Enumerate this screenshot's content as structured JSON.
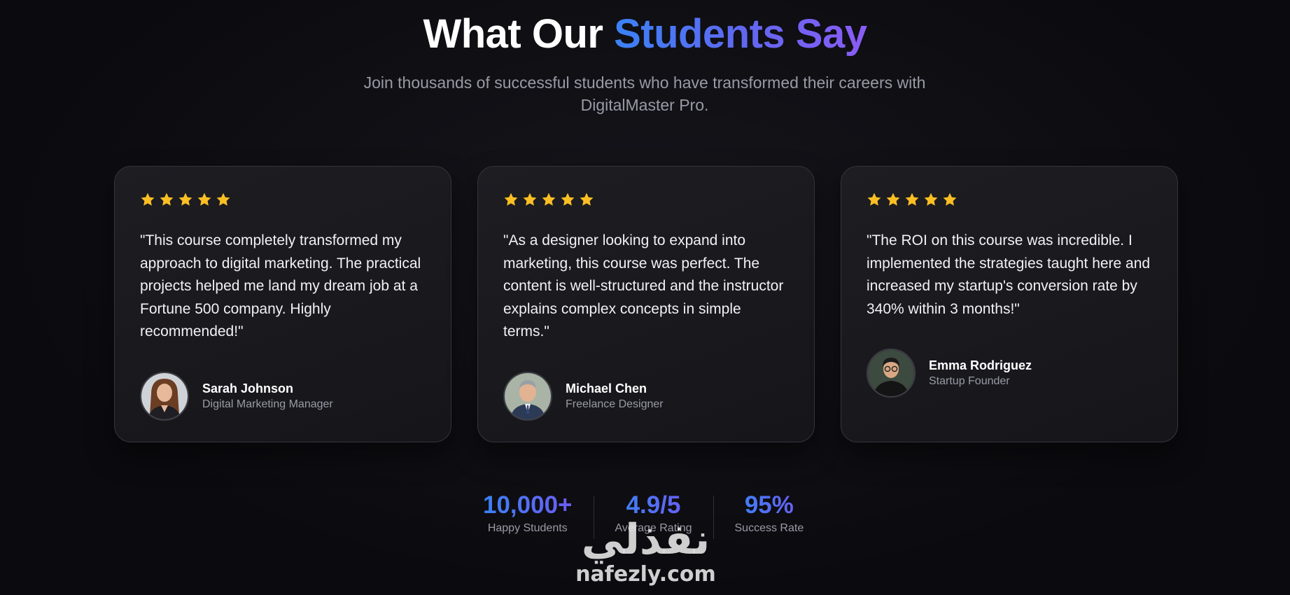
{
  "header": {
    "title_plain": "What Our ",
    "title_highlight": "Students Say",
    "subtitle": "Join thousands of successful students who have transformed their careers with DigitalMaster Pro."
  },
  "colors": {
    "star": "#fbbf24",
    "accent_start": "#3b82f6",
    "accent_end": "#8b5cf6"
  },
  "testimonials": [
    {
      "rating": 5,
      "quote": "\"This course completely transformed my approach to digital marketing. The practical projects helped me land my dream job at a Fortune 500 company. Highly recommended!\"",
      "name": "Sarah Johnson",
      "role": "Digital Marketing Manager",
      "avatar_icon": "woman-portrait"
    },
    {
      "rating": 5,
      "quote": "\"As a designer looking to expand into marketing, this course was perfect. The content is well-structured and the instructor explains complex concepts in simple terms.\"",
      "name": "Michael Chen",
      "role": "Freelance Designer",
      "avatar_icon": "man-portrait"
    },
    {
      "rating": 5,
      "quote": "\"The ROI on this course was incredible. I implemented the strategies taught here and increased my startup's conversion rate by 340% within 3 months!\"",
      "name": "Emma Rodriguez",
      "role": "Startup Founder",
      "avatar_icon": "man-glasses-portrait"
    }
  ],
  "stats": [
    {
      "value": "10,000+",
      "label": "Happy Students"
    },
    {
      "value": "4.9/5",
      "label": "Average Rating"
    },
    {
      "value": "95%",
      "label": "Success Rate"
    }
  ],
  "watermark": {
    "arabic": "نفذلي",
    "latin": "nafezly.com"
  }
}
